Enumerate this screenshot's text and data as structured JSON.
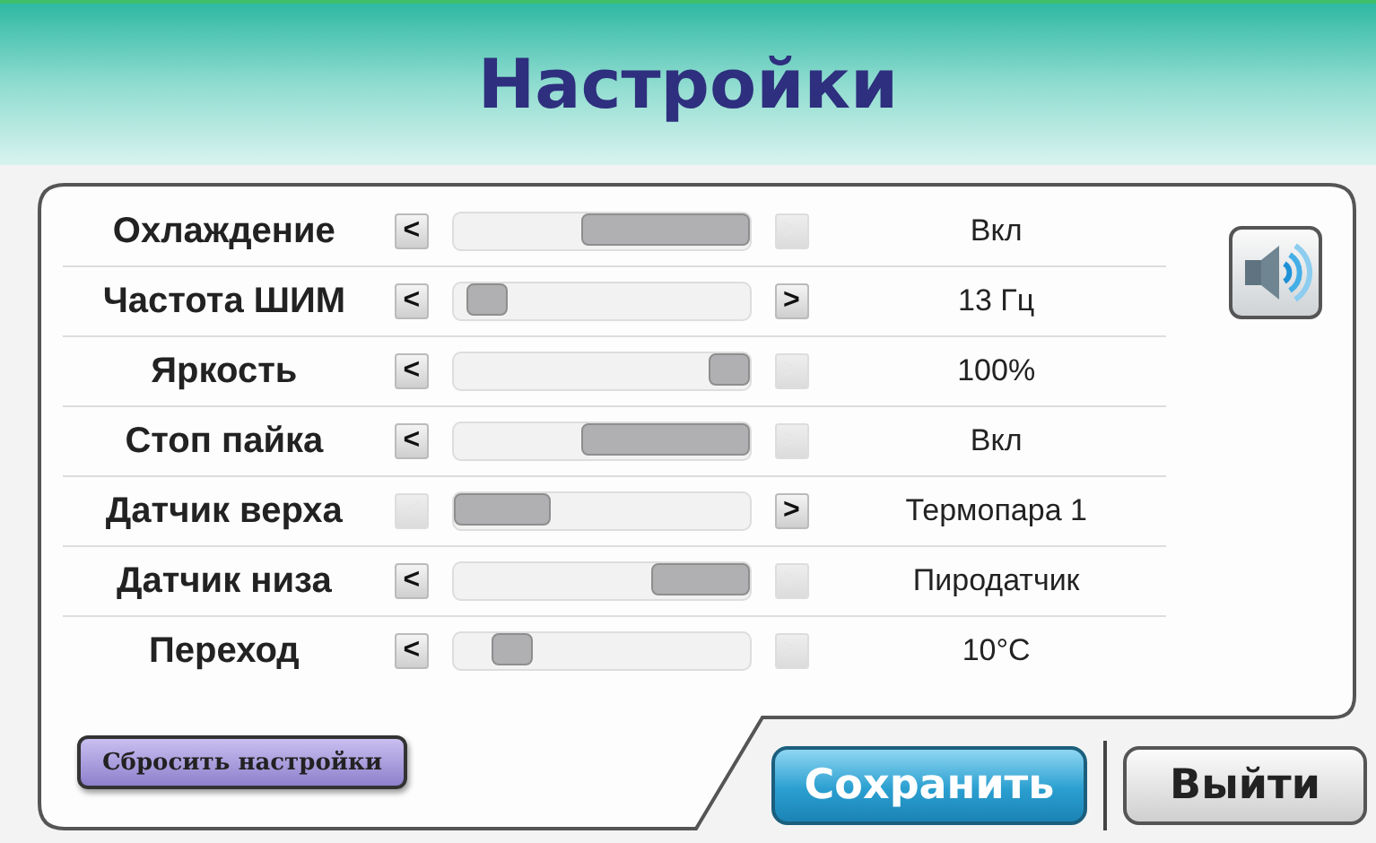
{
  "header": {
    "title": "Настройки"
  },
  "settings": [
    {
      "label": "Охлаждение",
      "kind": "switch",
      "level": 1,
      "prev_disabled": false,
      "next_disabled": true,
      "value": "Вкл"
    },
    {
      "label": "Частота ШИМ",
      "kind": "range",
      "level": 0.05,
      "prev_disabled": false,
      "next_disabled": false,
      "value": "13 Гц"
    },
    {
      "label": "Яркость",
      "kind": "range",
      "level": 1,
      "prev_disabled": false,
      "next_disabled": true,
      "value": "100%"
    },
    {
      "label": "Стоп пайка",
      "kind": "switch",
      "level": 1,
      "prev_disabled": false,
      "next_disabled": true,
      "value": "Вкл"
    },
    {
      "label": "Датчик верха",
      "kind": "choice",
      "level": 0,
      "prev_disabled": true,
      "next_disabled": false,
      "value": "Термопара 1"
    },
    {
      "label": "Датчик низа",
      "kind": "choice",
      "level": 1,
      "prev_disabled": false,
      "next_disabled": true,
      "value": "Пиродатчик"
    },
    {
      "label": "Переход",
      "kind": "range",
      "level": 0.15,
      "prev_disabled": false,
      "next_disabled": true,
      "value": "10°C"
    }
  ],
  "arrows": {
    "prev": "<",
    "next": ">"
  },
  "reset_button": "Сбросить настройки",
  "buttons": [
    {
      "label": "Сохранить",
      "kind": "primary"
    },
    {
      "label": "Выйти",
      "kind": "secondary"
    }
  ]
}
